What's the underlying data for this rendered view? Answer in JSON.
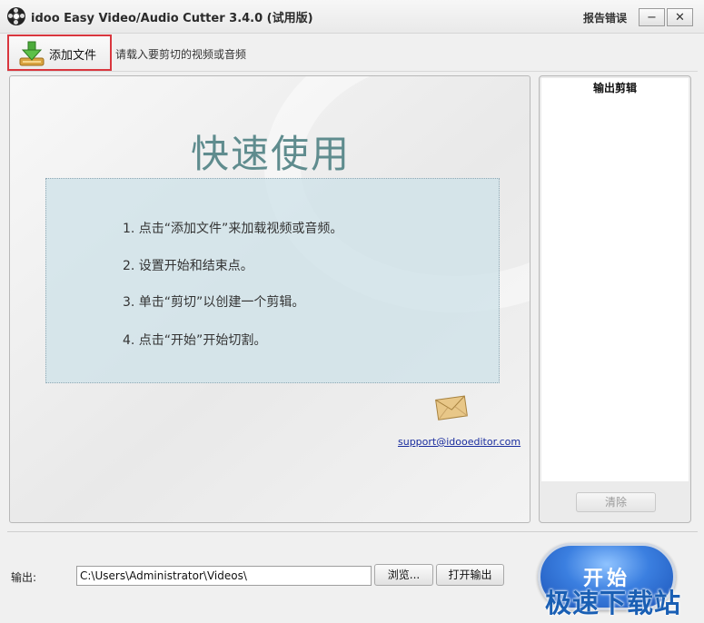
{
  "window": {
    "title": "idoo Easy Video/Audio Cutter 3.4.0 (试用版)",
    "report_error": "报告错误",
    "minimize": "−",
    "close": "✕"
  },
  "toolbar": {
    "add_file_label": "添加文件",
    "hint": "请载入要剪切的视频或音频"
  },
  "main": {
    "quick_start_title": "快速使用",
    "steps": [
      "1. 点击“添加文件”来加载视频或音频。",
      "2. 设置开始和结束点。",
      "3. 单击“剪切”以创建一个剪辑。",
      "4. 点击“开始”开始切割。"
    ],
    "support_link": "support@idooeditor.com"
  },
  "right_panel": {
    "title": "输出剪辑",
    "clear_label": "清除"
  },
  "bottom": {
    "output_label": "输出:",
    "output_path": "C:\\Users\\Administrator\\Videos\\",
    "browse_label": "浏览...",
    "open_output_label": "打开输出",
    "start_label": "开始"
  },
  "watermark": "极速下载站",
  "colors": {
    "accent_blue": "#3b7fe0",
    "title_teal": "#5f8c8e",
    "highlight_red": "#d9363e",
    "link_blue": "#1a2d9e"
  },
  "icons": {
    "app": "film-reel-icon",
    "add_file": "download-arrow-icon",
    "support": "envelope-icon"
  }
}
